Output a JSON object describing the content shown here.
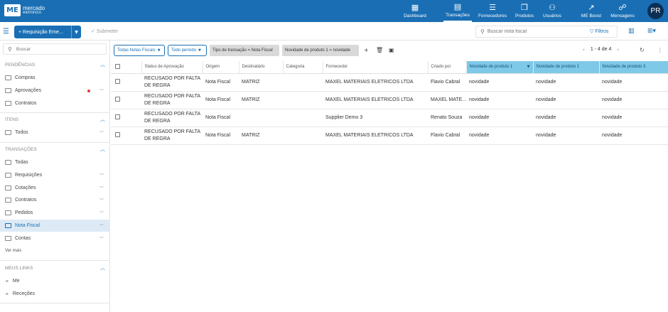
{
  "brand": {
    "line1": "mercado",
    "line2": "eletrônico",
    "mark": "ME"
  },
  "nav": [
    {
      "label": "Dashboard",
      "icon": "dashboard-icon",
      "glyph": "▦"
    },
    {
      "label": "Transações",
      "icon": "document-icon",
      "glyph": "▤"
    },
    {
      "label": "Fornecedores",
      "icon": "database-icon",
      "glyph": "☰"
    },
    {
      "label": "Produtos",
      "icon": "box-icon",
      "glyph": "❒"
    },
    {
      "label": "Usuários",
      "icon": "users-icon",
      "glyph": "⚇"
    },
    {
      "label": "ME Boost",
      "icon": "chart-line-icon",
      "glyph": "↗"
    },
    {
      "label": "Mensagens",
      "icon": "chat-icon",
      "glyph": "☍"
    }
  ],
  "user_initials": "PR",
  "toolbar": {
    "new_request": "Requisição Eme...",
    "submit": "Submeter",
    "search_placeholder": "Buscar nota fiscal",
    "filters": "Filtros"
  },
  "sidebar": {
    "search_placeholder": "Buscar",
    "pendencias_title": "PENDÊNCIAS",
    "pendencias": [
      "Compras",
      "Aprovações",
      "Contratos"
    ],
    "itens_title": "ITENS",
    "itens": [
      "Todos"
    ],
    "transacoes_title": "TRANSAÇÕES",
    "transacoes": [
      "Todas",
      "Requisições",
      "Cotações",
      "Contratos",
      "Pedidos",
      "Nota Fiscal",
      "Contas"
    ],
    "ver_mais": "Ver mais",
    "links_title": "MEUS LINKS",
    "links": [
      "Me",
      "Receções"
    ]
  },
  "filters": {
    "chip1": "Todas Notas Fiscais",
    "chip2": "Todo período",
    "tag1": "Tipo de transação = Nota Fiscal",
    "tag2": "Novidade de produto 1 = novidade",
    "pagination": "1 - 4 de 4"
  },
  "table": {
    "columns": [
      "Status de Aprovação",
      "Origem",
      "Destinatário",
      "Categoria",
      "Fornecedor",
      "Criado por",
      "Novidade de produto 1",
      "Novidade de produto 1",
      "Novidade de produto 3"
    ],
    "rows": [
      [
        "RECUSADO POR FALTA DE REGRA",
        "Nota Fiscal",
        "MATRIZ",
        "",
        "MAXEL MATERIAIS ELETRICOS LTDA",
        "Flavio Cabral",
        "novidade",
        "novidade",
        "novidade"
      ],
      [
        "RECUSADO POR FALTA DE REGRA",
        "Nota Fiscal",
        "MATRIZ",
        "",
        "MAXEL MATERIAIS ELETRICOS LTDA",
        "MAXEL MATE...",
        "novidade",
        "novidade",
        "novidade"
      ],
      [
        "RECUSADO POR FALTA DE REGRA",
        "Nota Fiscal",
        "",
        "",
        "Supplier Demo 3",
        "Renato Souza",
        "novidade",
        "novidade",
        "novidade"
      ],
      [
        "RECUSADO POR FALTA DE REGRA",
        "Nota Fiscal",
        "MATRIZ",
        "",
        "MAXEL MATERIAIS ELETRICOS LTDA",
        "Flavio Cabral",
        "novidade",
        "novidade",
        "novidade"
      ]
    ]
  },
  "colors": {
    "primary": "#1a6fb4",
    "highlight_header": "#7ec8e8",
    "active_item": "#ddeaf6"
  }
}
